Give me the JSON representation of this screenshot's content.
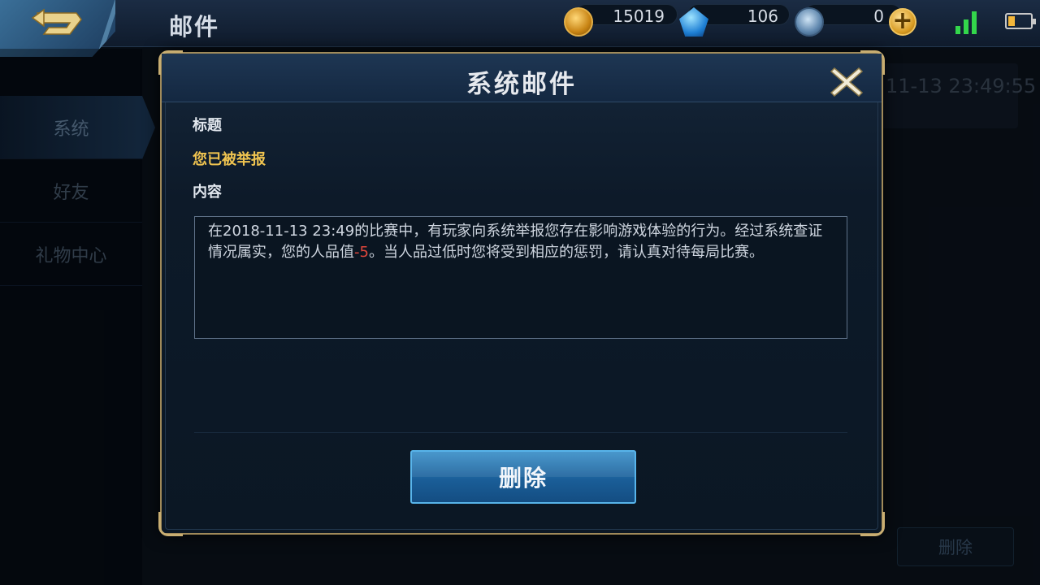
{
  "topbar": {
    "title": "邮件",
    "back_icon": "back-arrow-icon",
    "currencies": [
      {
        "name": "gold",
        "icon": "gold-coin-icon",
        "value": "15019"
      },
      {
        "name": "diamond",
        "icon": "diamond-icon",
        "value": "106"
      },
      {
        "name": "coupon",
        "icon": "coupon-icon",
        "value": "0"
      }
    ],
    "add_icon": "plus-icon",
    "signal_icon": "signal-bars-icon",
    "battery_icon": "battery-icon"
  },
  "sidebar": {
    "items": [
      {
        "label": "系统",
        "active": true
      },
      {
        "label": "好友",
        "active": false
      },
      {
        "label": "礼物中心",
        "active": false
      }
    ]
  },
  "background": {
    "mail_time": "11-13 23:49:55",
    "delete_label": "删除"
  },
  "modal": {
    "title": "系统邮件",
    "close_icon": "close-icon",
    "subject_label": "标题",
    "subject": "您已被举报",
    "content_label": "内容",
    "content_before": "在2018-11-13 23:49的比赛中，有玩家向系统举报您存在影响游戏体验的行为。经过系统查证情况属实，您的人品值",
    "content_value": "-5",
    "content_after": "。当人品过低时您将受到相应的惩罚，请认真对待每局比赛。",
    "delete_label": "删除"
  },
  "colors": {
    "accent_gold": "#c9ae72",
    "subject_yellow": "#f0c450",
    "negative_red": "#e0473c",
    "button_blue": "#1a5e98",
    "signal_green": "#33d64b"
  }
}
